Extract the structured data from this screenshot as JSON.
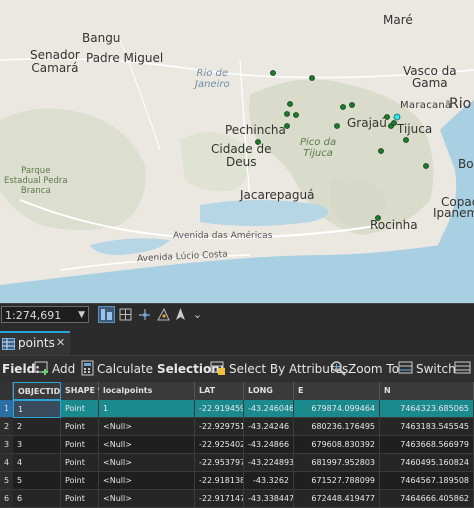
{
  "map": {
    "labels": {
      "bangu": "Bangu",
      "senador_camara": "Senador\nCamará",
      "padre_miguel": "Padre Miguel",
      "rio_de_janeiro": "Rio de\nJaneiro",
      "mare": "Maré",
      "vasco_da_gama": "Vasco da\nGama",
      "maracana": "Maracanã",
      "rio": "Rio",
      "grajau": "Grajaú",
      "tijuca": "Tijuca",
      "pechincha": "Pechincha",
      "cidade_de_deus": "Cidade de\nDeus",
      "pico_da_tijuca": "Pico da\nTijuca",
      "parque_pedra_branca": "Parque\nEstadual Pedra\nBranca",
      "jacarepagua": "Jacarepaguá",
      "bo": "Bo",
      "copac": "Copac",
      "ipanem": "Ipanem",
      "rocinha": "Rocinha",
      "av_americas": "Avenida das Américas",
      "av_lucio_costa": "Avenida Lúcio Costa"
    }
  },
  "toolbar": {
    "scale_value": "1:274,691"
  },
  "tab": {
    "label": "points"
  },
  "fieldbar": {
    "field_label": "Field:",
    "add_label": "Add",
    "calculate_label": "Calculate",
    "selection_label": "Selection:",
    "select_by_attributes_label": "Select By Attributes",
    "zoom_to_label": "Zoom To",
    "switch_label": "Switch"
  },
  "table": {
    "columns": [
      "OBJECTID *",
      "SHAPE *",
      "localpoints",
      "LAT",
      "LONG",
      "E",
      "N"
    ],
    "rows": [
      {
        "num": "1",
        "cells": [
          "1",
          "Point",
          "1",
          "-22.919459",
          "-43.246046",
          "679874.099464",
          "7464323.685065"
        ],
        "selected": true
      },
      {
        "num": "2",
        "cells": [
          "2",
          "Point",
          "<Null>",
          "-22.929751",
          "-43.24246",
          "680236.176495",
          "7463183.545545"
        ],
        "selected": false
      },
      {
        "num": "3",
        "cells": [
          "3",
          "Point",
          "<Null>",
          "-22.925402",
          "-43.24866",
          "679608.830392",
          "7463668.566979"
        ],
        "selected": false
      },
      {
        "num": "4",
        "cells": [
          "4",
          "Point",
          "<Null>",
          "-22.953797",
          "-43.224893",
          "681997.952803",
          "7460495.160824"
        ],
        "selected": false
      },
      {
        "num": "5",
        "cells": [
          "5",
          "Point",
          "<Null>",
          "-22.918138",
          "-43.3262",
          "671527.788099",
          "7464567.189508"
        ],
        "selected": false
      },
      {
        "num": "6",
        "cells": [
          "6",
          "Point",
          "<Null>",
          "-22.917147",
          "-43.338447",
          "672448.419477",
          "7464666.405862"
        ],
        "selected": false
      }
    ]
  },
  "colors": {
    "selected_row": "#1b8a8f",
    "accent": "#2aa3d8",
    "point_fill": "#1f7a2e"
  }
}
